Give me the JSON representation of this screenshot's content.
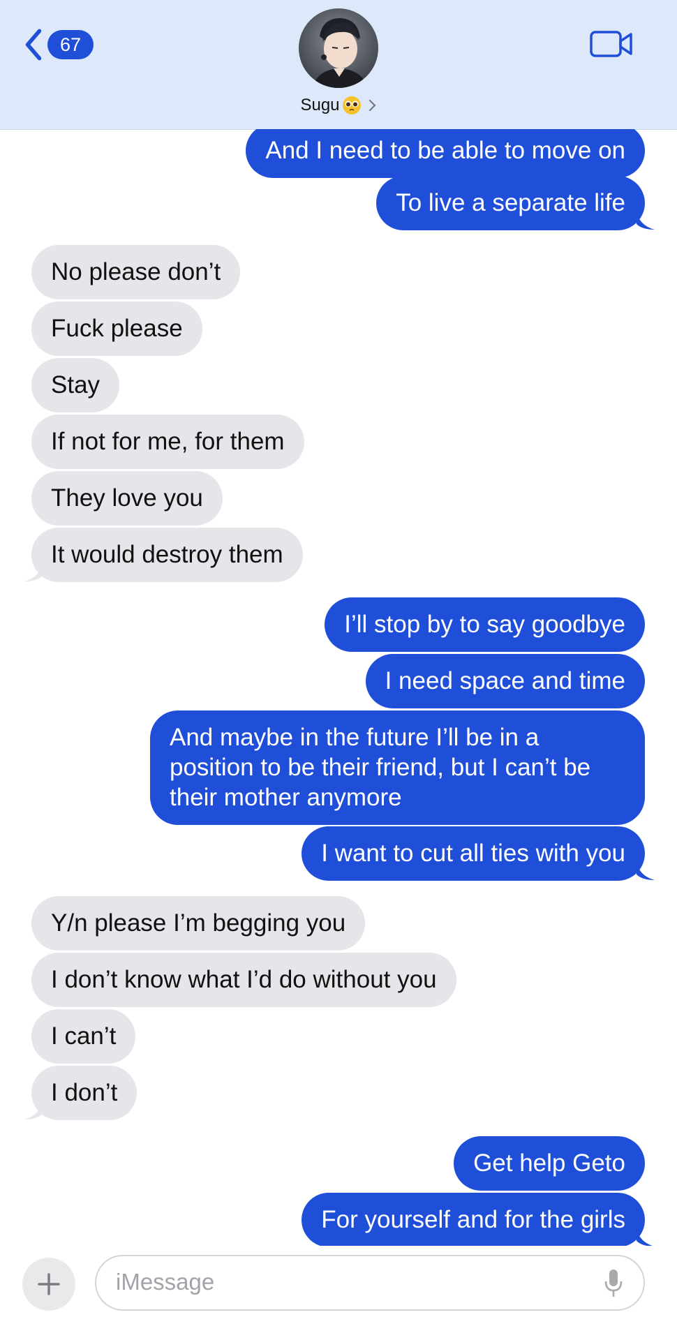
{
  "header": {
    "back_badge": "67",
    "contact_name": "Sugu",
    "contact_emoji": "pleading-face"
  },
  "colors": {
    "outgoing_bubble": "#1f4fd8",
    "incoming_bubble": "#e5e5ea",
    "header_bg": "#dde9fa",
    "accent": "#1f4fd8"
  },
  "messages": [
    {
      "direction": "out",
      "text": "And I need to be able to move on"
    },
    {
      "direction": "out",
      "text": "To live a separate life"
    },
    {
      "direction": "in",
      "text": "No please don’t"
    },
    {
      "direction": "in",
      "text": "Fuck please"
    },
    {
      "direction": "in",
      "text": "Stay"
    },
    {
      "direction": "in",
      "text": "If not for me, for them"
    },
    {
      "direction": "in",
      "text": "They love you"
    },
    {
      "direction": "in",
      "text": "It would destroy them"
    },
    {
      "direction": "out",
      "text": "I’ll stop by to say goodbye"
    },
    {
      "direction": "out",
      "text": "I need space and time"
    },
    {
      "direction": "out",
      "text": "And maybe in the future I’ll be in a position to be their friend, but I can’t be their mother anymore"
    },
    {
      "direction": "out",
      "text": "I want to cut all ties with you"
    },
    {
      "direction": "in",
      "text": "Y/n please I’m begging you"
    },
    {
      "direction": "in",
      "text": "I don’t know what I’d do without you"
    },
    {
      "direction": "in",
      "text": "I can’t"
    },
    {
      "direction": "in",
      "text": "I don’t"
    },
    {
      "direction": "out",
      "text": "Get help Geto"
    },
    {
      "direction": "out",
      "text": "For yourself and for the girls"
    }
  ],
  "composer": {
    "placeholder": "iMessage",
    "plus_icon": "plus-icon",
    "mic_icon": "microphone-icon"
  }
}
